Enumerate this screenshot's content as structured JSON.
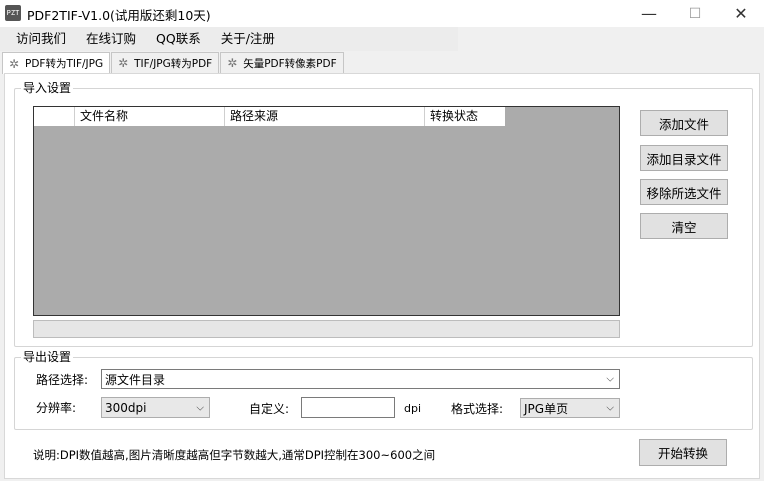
{
  "window": {
    "icon_text": "PZT",
    "title": "PDF2TIF-V1.0(试用版还剩10天)",
    "minimize_glyph": "—",
    "maximize_glyph": "☐",
    "close_glyph": "✕"
  },
  "menu": [
    "访问我们",
    "在线订购",
    "QQ联系",
    "关于/注册"
  ],
  "tabs": [
    {
      "label": "PDF转为TIF/JPG",
      "icon": "gear-icon",
      "active": true
    },
    {
      "label": "TIF/JPG转为PDF",
      "icon": "gear-icon",
      "active": false
    },
    {
      "label": "矢量PDF转像素PDF",
      "icon": "gear-icon",
      "active": false
    }
  ],
  "import_group": {
    "title": "导入设置",
    "columns": [
      "",
      "文件名称",
      "路径来源",
      "转换状态"
    ],
    "buttons": {
      "add_file": "添加文件",
      "add_dir": "添加目录文件",
      "remove": "移除所选文件",
      "clear": "清空"
    }
  },
  "export_group": {
    "title": "导出设置",
    "path_label": "路径选择:",
    "path_value": "源文件目录",
    "resolution_label": "分辨率:",
    "resolution_value": "300dpi",
    "custom_label": "自定义:",
    "custom_value": "",
    "dpi_unit": "dpi",
    "format_label": "格式选择:",
    "format_value": "JPG单页"
  },
  "footer": {
    "note": "说明:DPI数值越高,图片清晰度越高但字节数越大,通常DPI控制在300~600之间",
    "start_button": "开始转换"
  },
  "icons": {
    "dropdown": "⌵",
    "gear": "✲"
  }
}
